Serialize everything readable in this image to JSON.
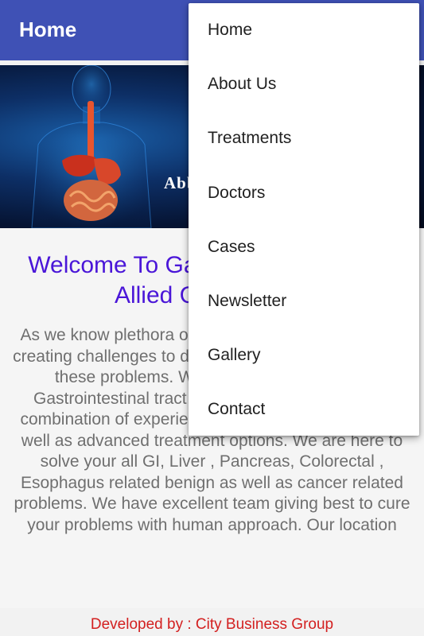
{
  "app_bar": {
    "title": "Home"
  },
  "hero": {
    "overlay_text": "Abb"
  },
  "content": {
    "welcome_heading": "Welcome To Gastroenterology And Allied Care Center",
    "body": "As we know plethora of diseases is ever expanding, creating challenges to doctors & is being able to solve these problems. We are here to solve your Gastrointestinal tract related problems. We have combination of experience and expertise in basic as well as advanced treatment options. We are here to solve your all GI, Liver , Pancreas, Colorectal , Esophagus related benign as well as cancer related problems. We have excellent team giving best to cure your problems with human approach. Our location"
  },
  "footer": {
    "text": "Developed by : City Business Group"
  },
  "menu": {
    "items": [
      {
        "label": "Home"
      },
      {
        "label": "About Us"
      },
      {
        "label": "Treatments"
      },
      {
        "label": "Doctors"
      },
      {
        "label": "Cases"
      },
      {
        "label": "Newsletter"
      },
      {
        "label": "Gallery"
      },
      {
        "label": "Contact"
      }
    ]
  },
  "colors": {
    "app_bar": "#3f51b5",
    "heading": "#4a16d8",
    "body_text": "#6f6f6f",
    "footer_text": "#d32020"
  }
}
